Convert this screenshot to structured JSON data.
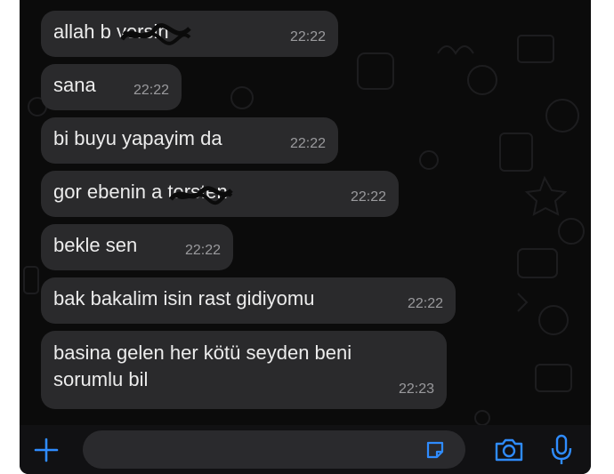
{
  "messages": [
    {
      "text": "allah b      versin",
      "time": "22:22"
    },
    {
      "text": "sana",
      "time": "22:22"
    },
    {
      "text": "bi buyu yapayim da",
      "time": "22:22"
    },
    {
      "text": "gor ebenin a      tersten",
      "time": "22:22"
    },
    {
      "text": "bekle sen",
      "time": "22:22"
    },
    {
      "text": "bak bakalim isin rast gidiyomu",
      "time": "22:22"
    },
    {
      "text": "basina gelen her kötü seyden beni\nsorumlu bil",
      "time": "22:23"
    }
  ],
  "input_bar": {
    "placeholder": "",
    "icons": [
      "plus-icon",
      "sticker-icon",
      "camera-icon",
      "microphone-icon"
    ]
  },
  "colors": {
    "background": "#0b0b0b",
    "bubble": "#2a2a2c",
    "text": "#ececec",
    "timestamp": "#9a9a9d",
    "accent": "#2f8cff"
  }
}
